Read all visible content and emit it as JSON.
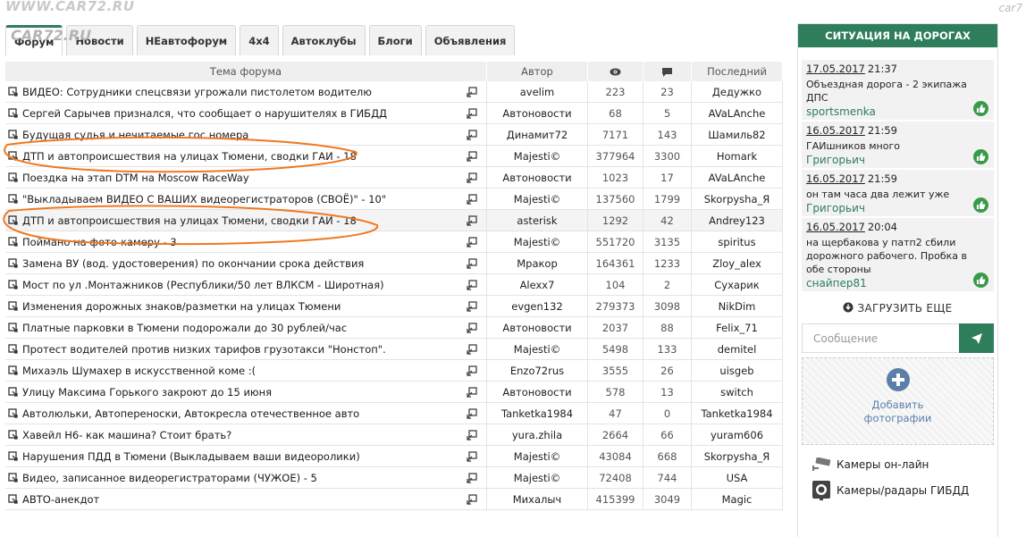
{
  "watermark": {
    "site": "WWW.CAR72.RU",
    "corner": "car7"
  },
  "tabs": [
    {
      "label": "Форум",
      "active": true
    },
    {
      "label": "Новости",
      "active": false
    },
    {
      "label": "НЕавтофорум",
      "active": false
    },
    {
      "label": "4x4",
      "active": false
    },
    {
      "label": "Автоклубы",
      "active": false
    },
    {
      "label": "Блоги",
      "active": false
    },
    {
      "label": "Объявления",
      "active": false
    }
  ],
  "table": {
    "headers": {
      "topic": "Тема форума",
      "author": "Автор",
      "views_icon": "eye-icon",
      "posts_icon": "comment-icon",
      "last": "Последний"
    },
    "rows": [
      {
        "title": "ВИДЕО: Сотрудники спецсвязи угрожали пистолетом водителю",
        "author": "avelim",
        "views": "223",
        "posts": "23",
        "last": "Дедужко"
      },
      {
        "title": "Сергей Сарычев признался, что сообщает о нарушителях в ГИБДД",
        "author": "Автоновости",
        "views": "68",
        "posts": "5",
        "last": "AVaLAnche"
      },
      {
        "title": "Будущая судья и нечитаемые гос.номера",
        "author": "Динамит72",
        "views": "7171",
        "posts": "143",
        "last": "Шамиль82"
      },
      {
        "title": "ДТП и автопроисшествия на улицах Тюмени, сводки ГАИ - 18",
        "author": "Majesti©",
        "views": "377964",
        "posts": "3300",
        "last": "Homark"
      },
      {
        "title": "Поездка на этап DTM на Moscow RaceWay",
        "author": "Автоновости",
        "views": "1023",
        "posts": "17",
        "last": "AVaLAnche"
      },
      {
        "title": "\"Выкладываем ВИДЕО С ВАШИХ видеорегистраторов (СВОЁ)\" - 10\"",
        "author": "Majesti©",
        "views": "137560",
        "posts": "1799",
        "last": "Skorpysha_Я"
      },
      {
        "title": "ДТП и автопроисшествия на улицах Тюмени, сводки ГАИ - 18",
        "author": "asterisk",
        "views": "1292",
        "posts": "42",
        "last": "Andrey123",
        "highlight": true
      },
      {
        "title": "Поймано на фото-камеру - 3",
        "author": "Majesti©",
        "views": "551720",
        "posts": "3135",
        "last": "spiritus"
      },
      {
        "title": "Замена ВУ (вод. удостоверения) по окончании срока действия",
        "author": "Мракор",
        "views": "164361",
        "posts": "1233",
        "last": "Zloy_alex"
      },
      {
        "title": "Мост по ул .Монтажников (Республики/50 лет ВЛКСМ - Широтная)",
        "author": "Alexx7",
        "views": "104",
        "posts": "2",
        "last": "Сухарик"
      },
      {
        "title": "Изменения дорожных знаков/разметки на улицах Тюмени",
        "author": "evgen132",
        "views": "279373",
        "posts": "3098",
        "last": "NikDim"
      },
      {
        "title": "Платные парковки в Тюмени подорожали до 30 рублей/час",
        "author": "Автоновости",
        "views": "2037",
        "posts": "88",
        "last": "Felix_71"
      },
      {
        "title": "Протест водителей против низких тарифов грузотакси \"Нонстоп\".",
        "author": "Majesti©",
        "views": "5498",
        "posts": "133",
        "last": "demitel"
      },
      {
        "title": "Михаэль Шумахер в искусственной коме :(",
        "author": "Enzo72rus",
        "views": "3555",
        "posts": "26",
        "last": "uisgeb"
      },
      {
        "title": "Улицу Максима Горького закроют до 15 июня",
        "author": "Автоновости",
        "views": "578",
        "posts": "13",
        "last": "switch"
      },
      {
        "title": "Автолюльки, Автопереноски, Автокресла отечественное авто",
        "author": "Tanketka1984",
        "views": "47",
        "posts": "0",
        "last": "Tanketka1984"
      },
      {
        "title": "Хавейл Н6- как машина? Стоит брать?",
        "author": "yura.zhila",
        "views": "2664",
        "posts": "66",
        "last": "yuram606"
      },
      {
        "title": "Нарушения ПДД в Тюмени (Выкладываем ваши видеоролики)",
        "author": "Majesti©",
        "views": "43084",
        "posts": "668",
        "last": "Skorpysha_Я"
      },
      {
        "title": "Видео, записанное видеорегистраторами (ЧУЖОЕ) - 5",
        "author": "Majesti©",
        "views": "72408",
        "posts": "744",
        "last": "USA"
      },
      {
        "title": "АВТО-анекдот",
        "author": "Михалыч",
        "views": "415399",
        "posts": "3049",
        "last": "Magic"
      }
    ]
  },
  "sidebar": {
    "title": "СИТУАЦИЯ НА ДОРОГАХ",
    "news": [
      {
        "date": "17.05.2017",
        "time": "21:37",
        "text": "Объездная дорога - 2 экипажа ДПС",
        "user": "sportsmenka"
      },
      {
        "date": "16.05.2017",
        "time": "21:59",
        "text": "ГАИшников много",
        "user": "Григорьич"
      },
      {
        "date": "16.05.2017",
        "time": "21:59",
        "text": "он там часа два лежит уже",
        "user": "Григорьич"
      },
      {
        "date": "16.05.2017",
        "time": "20:04",
        "text": "на щербакова у патп2 сбили дорожного рабочего. Пробка в обе стороны",
        "user": "снайпер81"
      }
    ],
    "load_more": "ЗАГРУЗИТЬ ЕЩЕ",
    "message_placeholder": "Сообщение",
    "add_photo_line1": "Добавить",
    "add_photo_line2": "фотографии",
    "links": [
      {
        "label": "Камеры он-лайн",
        "icon": "cctv-camera-icon"
      },
      {
        "label": "Камеры/радары ГИБДД",
        "icon": "speed-camera-icon"
      }
    ]
  },
  "colors": {
    "accent": "#2e7d5b",
    "annotation": "#f07820"
  }
}
